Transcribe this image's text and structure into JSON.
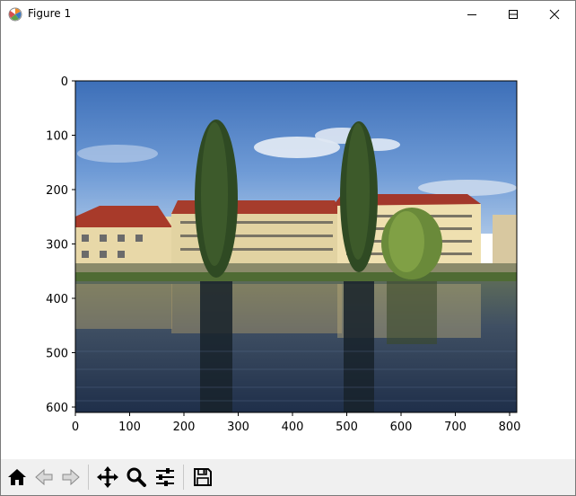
{
  "window": {
    "title": "Figure 1",
    "icon": "matplotlib-icon",
    "controls": [
      "minimize-icon",
      "maximize-icon",
      "close-icon"
    ]
  },
  "axes": {
    "x_ticks": [
      "0",
      "100",
      "200",
      "300",
      "400",
      "500",
      "600",
      "700",
      "800"
    ],
    "y_ticks": [
      "0",
      "100",
      "200",
      "300",
      "400",
      "500",
      "600"
    ],
    "image_description_icon": "photo"
  },
  "toolbar": {
    "buttons": [
      {
        "name": "home-button",
        "icon": "home-icon",
        "enabled": true
      },
      {
        "name": "back-button",
        "icon": "arrow-left-icon",
        "enabled": false
      },
      {
        "name": "forward-button",
        "icon": "arrow-right-icon",
        "enabled": false
      },
      {
        "name": "pan-button",
        "icon": "move-icon",
        "enabled": true
      },
      {
        "name": "zoom-button",
        "icon": "magnifier-icon",
        "enabled": true
      },
      {
        "name": "configure-subplots-button",
        "icon": "sliders-icon",
        "enabled": true
      },
      {
        "name": "save-button",
        "icon": "floppy-disk-icon",
        "enabled": true
      }
    ]
  },
  "colors": {
    "toolbar_bg": "#f0f0f0",
    "sky": "#4a7fc4",
    "water": "#2b3d57"
  }
}
